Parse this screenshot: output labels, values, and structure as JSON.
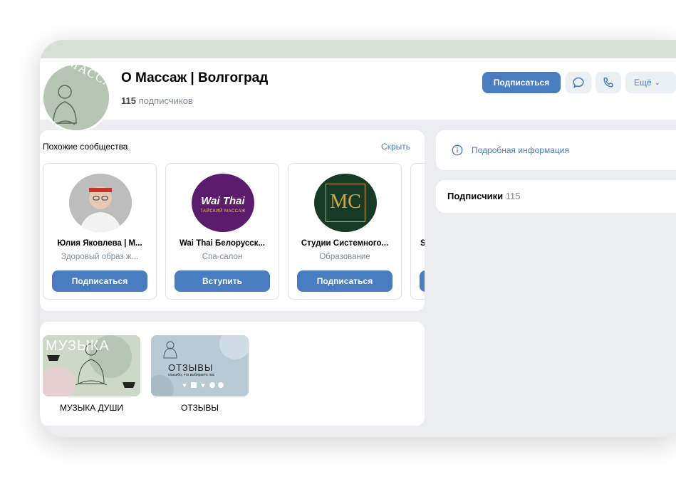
{
  "header": {
    "group_name": "О Массаж | Волгоград",
    "subscribers_count": "115",
    "subscribers_label": "подписчиков",
    "avatar_text": "МАССАЖ",
    "subscribe_label": "Подписаться",
    "more_label": "Ещё"
  },
  "similar": {
    "title": "Похожие сообщества",
    "hide_label": "Скрыть",
    "items": [
      {
        "name": "Юлия Яковлева | М...",
        "category": "Здоровый образ ж...",
        "button": "Подписаться"
      },
      {
        "name": "Wai Thai Белорусск...",
        "category": "Спа-салон",
        "button": "Вступить",
        "logo_main": "Wai Thai",
        "logo_sub": "ТАЙСКИЙ МАССАЖ"
      },
      {
        "name": "Студии Системного...",
        "category": "Образование",
        "button": "Подписаться",
        "logo_main": "MC"
      },
      {
        "name": "S"
      }
    ]
  },
  "albums": [
    {
      "caption": "МУЗЫКА ДУШИ",
      "thumb_text": "МУЗЫКА"
    },
    {
      "caption": "ОТЗЫВЫ",
      "thumb_text": "ОТЗЫВЫ",
      "thumb_sub": "спасибо, что выбираете нас"
    }
  ],
  "right": {
    "info_label": "Подробная информация",
    "subscribers_title": "Подписчики",
    "subscribers_count": "115"
  },
  "colors": {
    "accent": "#4a7cc2",
    "background": "#ebedf0",
    "cover": "#d6e0d5"
  }
}
